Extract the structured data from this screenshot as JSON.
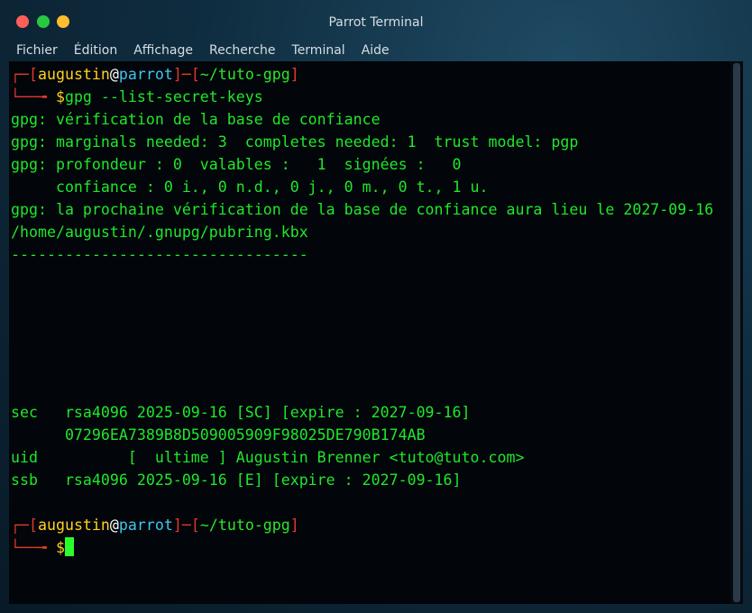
{
  "window": {
    "title": "Parrot Terminal"
  },
  "menu": {
    "items": [
      "Fichier",
      "Édition",
      "Affichage",
      "Recherche",
      "Terminal",
      "Aide"
    ]
  },
  "colors": {
    "prompt_frame": "#e1392b",
    "user": "#ffd21e",
    "host": "#3ec6f0",
    "output": "#1fe82a",
    "background": "#020509"
  },
  "prompt1": {
    "corner": "┌─",
    "open": "[",
    "user": "augustin",
    "at": "@",
    "host": "parrot",
    "close": "]",
    "dash": "─",
    "path_open": "[",
    "path": "~/tuto-gpg",
    "path_close": "]",
    "arrow": "└──╼ ",
    "dollar": "$",
    "command": "gpg --list-secret-keys"
  },
  "output": [
    "gpg: vérification de la base de confiance",
    "gpg: marginals needed: 3  completes needed: 1  trust model: pgp",
    "gpg: profondeur : 0  valables :   1  signées :   0",
    "     confiance : 0 i., 0 n.d., 0 j., 0 m., 0 t., 1 u.",
    "gpg: la prochaine vérification de la base de confiance aura lieu le 2027-09-16",
    "/home/augustin/.gnupg/pubring.kbx",
    "---------------------------------"
  ],
  "keys": [
    "sec   rsa4096 2025-09-16 [SC] [expire : 2027-09-16]",
    "      07296EA7389B8D509005909F98025DE790B174AB",
    "uid          [  ultime ] Augustin Brenner <tuto@tuto.com>",
    "ssb   rsa4096 2025-09-16 [E] [expire : 2027-09-16]"
  ],
  "prompt2": {
    "corner": "┌─",
    "open": "[",
    "user": "augustin",
    "at": "@",
    "host": "parrot",
    "close": "]",
    "dash": "─",
    "path_open": "[",
    "path": "~/tuto-gpg",
    "path_close": "]",
    "arrow": "└──╼ ",
    "dollar": "$"
  }
}
